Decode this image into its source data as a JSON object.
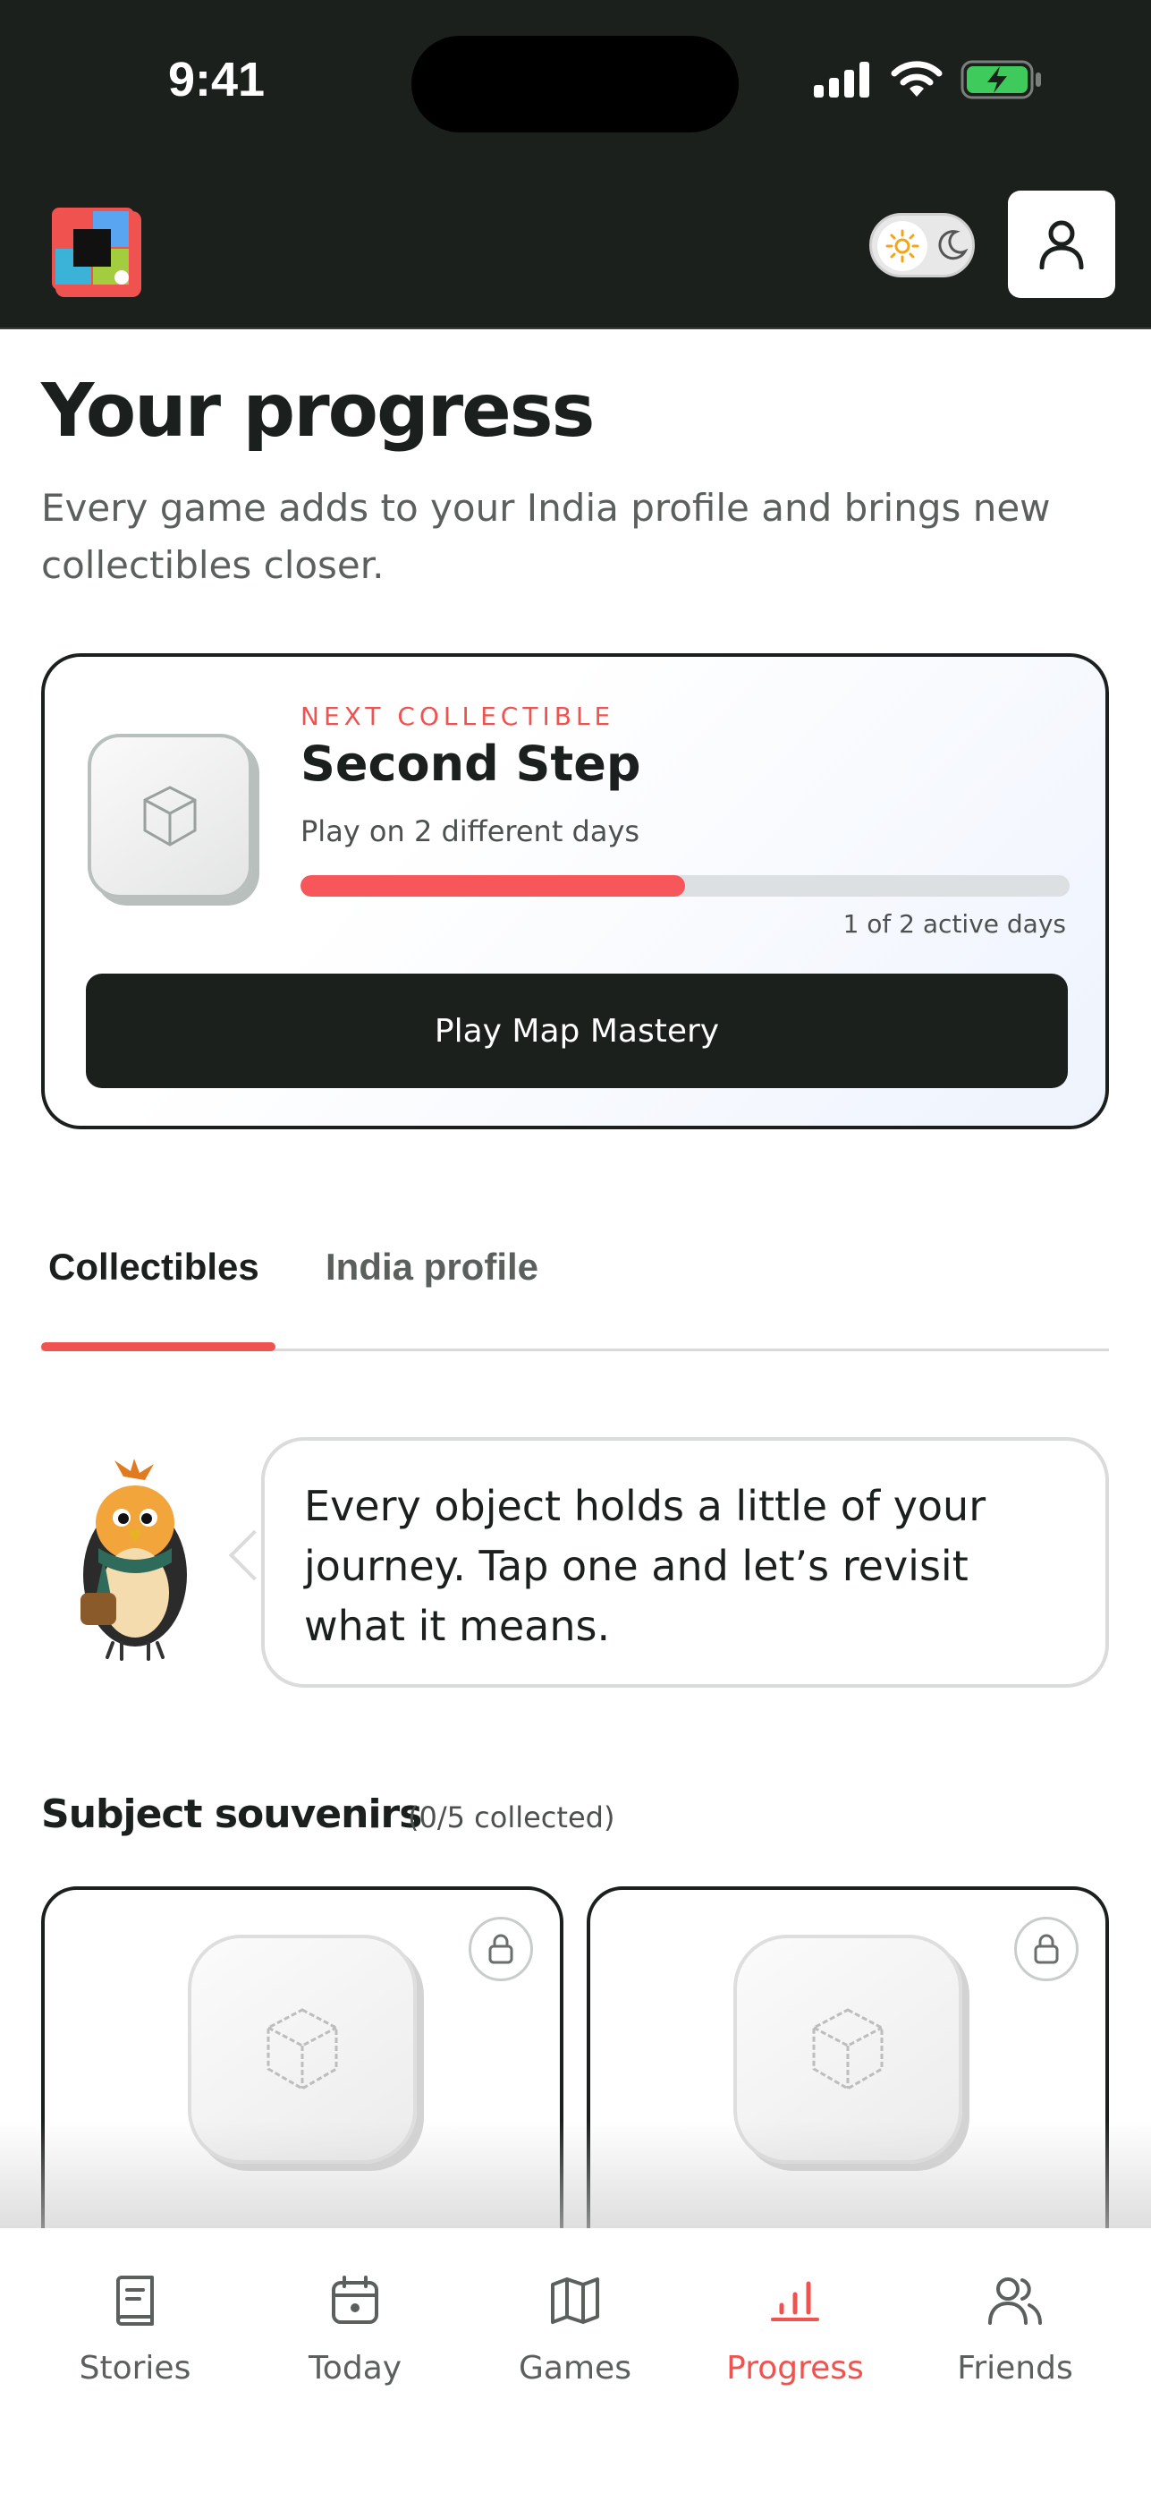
{
  "status_bar": {
    "time": "9:41"
  },
  "header": {
    "logo": "app-logo",
    "theme_toggle": "light-dark-toggle",
    "profile": "profile-icon"
  },
  "page": {
    "title": "Your progress",
    "subtitle": "Every game adds to your India profile and brings new collectibles closer."
  },
  "next_collectible": {
    "label": "NEXT COLLECTIBLE",
    "title": "Second Step",
    "description": "Play on 2 different days",
    "progress_fraction": 0.5,
    "progress_text": "1 of 2 active days",
    "cta": "Play Map Mastery",
    "icon": "cube-icon"
  },
  "tabs": [
    {
      "label": "Collectibles",
      "active": true
    },
    {
      "label": "India profile",
      "active": false
    }
  ],
  "mascot_message": "Every object holds a little of your journey. Tap one and let’s revisit what it means.",
  "souvenirs": {
    "title": "Subject souvenirs",
    "count": "(0/5 collected)",
    "cards": [
      {
        "icon": "cube-icon",
        "locked": true
      },
      {
        "icon": "cube-icon",
        "locked": true
      }
    ]
  },
  "nav": [
    {
      "label": "Stories",
      "icon": "book-icon",
      "active": false
    },
    {
      "label": "Today",
      "icon": "calendar-icon",
      "active": false
    },
    {
      "label": "Games",
      "icon": "map-icon",
      "active": false
    },
    {
      "label": "Progress",
      "icon": "bar-chart-icon",
      "active": true
    },
    {
      "label": "Friends",
      "icon": "users-icon",
      "active": false
    }
  ],
  "colors": {
    "accent": "#f0534f",
    "dark": "#1b201d",
    "progress_track": "#dde0e3"
  }
}
